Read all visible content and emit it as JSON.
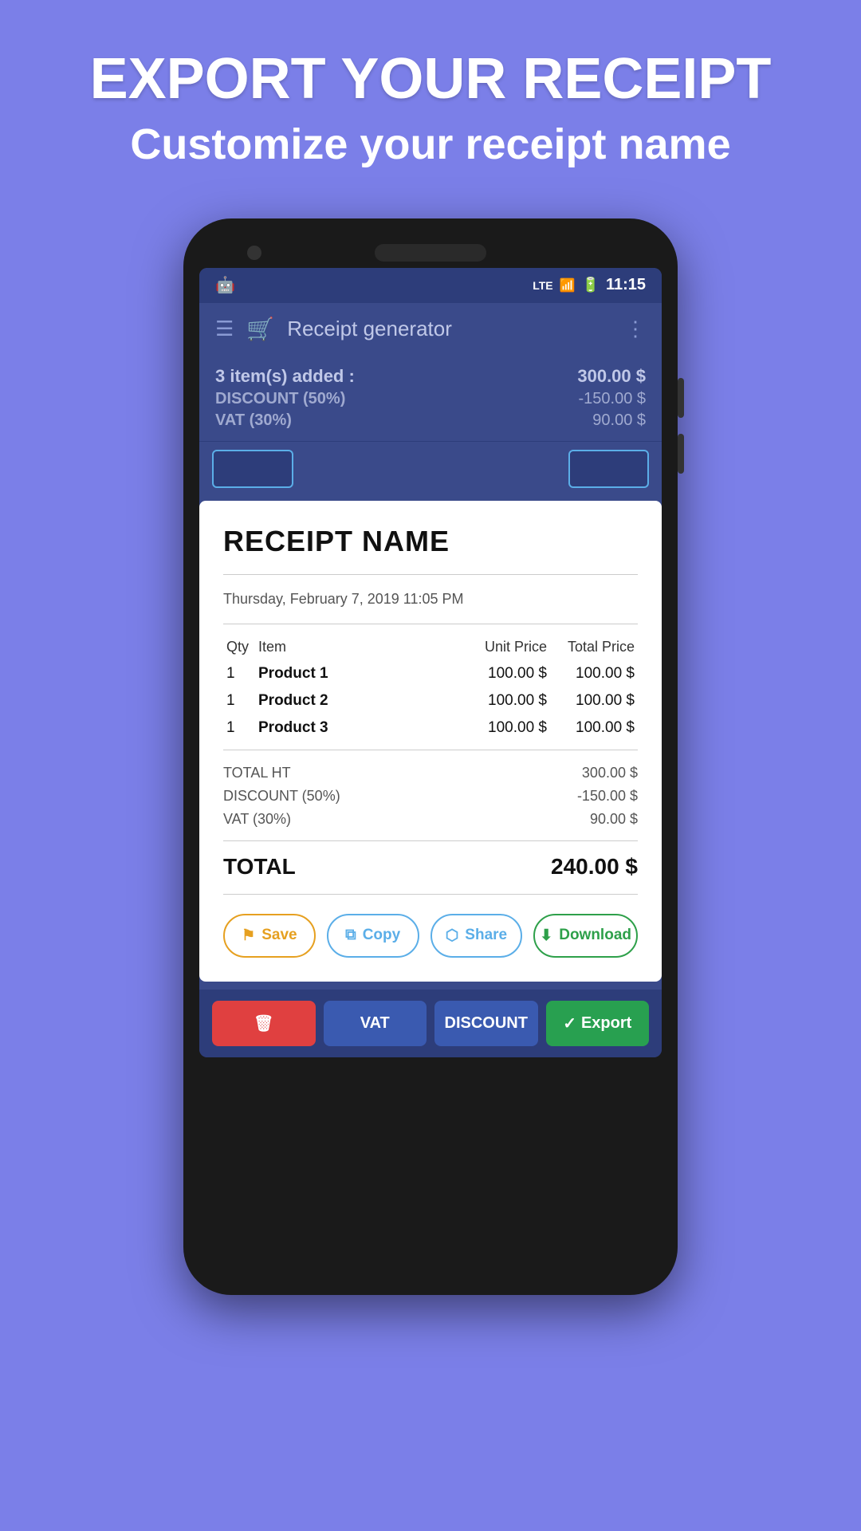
{
  "header": {
    "title": "EXPORT YOUR RECEIPT",
    "subtitle": "Customize your receipt name"
  },
  "status_bar": {
    "time": "11:15",
    "lte": "LTE",
    "android_icon": "🤖"
  },
  "app_bar": {
    "title": "Receipt generator"
  },
  "summary": {
    "items_label": "3 item(s) added :",
    "items_value": "300.00 $",
    "discount_label": "DISCOUNT (50%)",
    "discount_value": "-150.00 $",
    "vat_label": "VAT (30%)",
    "vat_value": "90.00 $"
  },
  "receipt": {
    "title": "RECEIPT NAME",
    "date": "Thursday, February 7, 2019 11:05 PM",
    "columns": {
      "qty": "Qty",
      "item": "Item",
      "unit_price": "Unit Price",
      "total_price": "Total Price"
    },
    "items": [
      {
        "qty": "1",
        "name": "Product 1",
        "unit_price": "100.00 $",
        "total_price": "100.00 $"
      },
      {
        "qty": "1",
        "name": "Product 2",
        "unit_price": "100.00 $",
        "total_price": "100.00 $"
      },
      {
        "qty": "1",
        "name": "Product 3",
        "unit_price": "100.00 $",
        "total_price": "100.00 $"
      }
    ],
    "totals": {
      "total_ht_label": "TOTAL HT",
      "total_ht_value": "300.00 $",
      "discount_label": "DISCOUNT (50%)",
      "discount_value": "-150.00 $",
      "vat_label": "VAT (30%)",
      "vat_value": "90.00 $",
      "grand_total_label": "TOTAL",
      "grand_total_value": "240.00 $"
    }
  },
  "action_buttons": {
    "save": "Save",
    "copy": "Copy",
    "share": "Share",
    "download": "Download"
  },
  "bottom_bar": {
    "delete": "🗑",
    "vat": "VAT",
    "discount": "DISCOUNT",
    "export_icon": "✓",
    "export": "Export"
  },
  "colors": {
    "background": "#7b7fe8",
    "app_bar": "#3a4a8a",
    "status_bar": "#2d3d7a",
    "receipt_bg": "#ffffff",
    "save_color": "#e6a020",
    "copy_color": "#5baee8",
    "share_color": "#5baee8",
    "download_color": "#2ea04a"
  }
}
